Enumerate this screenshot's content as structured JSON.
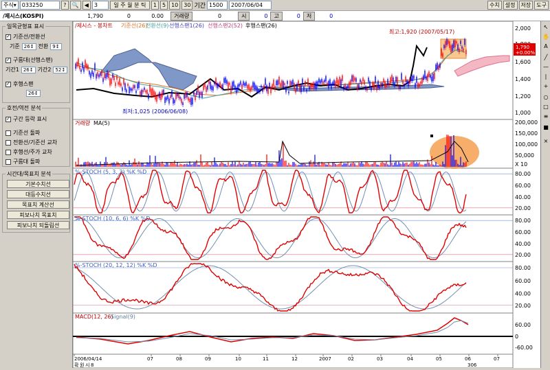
{
  "toolbar": {
    "market": "주식",
    "code": "033250",
    "count": "3",
    "mode": "일 주 월 분 틱",
    "periods": [
      "1",
      "5",
      "10",
      "30"
    ],
    "period_label": "기간",
    "period_value": "1500",
    "date": "2007/06/04",
    "right_buttons": [
      "수치",
      "설정",
      "저장",
      "도구"
    ]
  },
  "info": {
    "name": "/제시스(KOSPI)",
    "price": "1,790",
    "change": "0",
    "rate": "0.00",
    "vol_label": "거래량",
    "volume": "0",
    "open_label": "시",
    "open": "0",
    "high_label": "고",
    "high": "0",
    "low_label": "저",
    "low": "0"
  },
  "sidebar": {
    "ichimoku": {
      "title": "일목균형표 표시",
      "line1": "기준선/전환선",
      "base_label": "기준",
      "base_val": "26",
      "conv_label": "전환",
      "conv_val": "9",
      "cloud": "구름대(선행스팬)",
      "span1_label": "기간1",
      "span1_val": "26",
      "span2_label": "기간2",
      "span2_val": "52",
      "lag": "후행스팬",
      "lag_val": "26"
    },
    "signals": {
      "title": "호전/역전 분석",
      "items": [
        "구간 등락 표시",
        "기준선 돌파",
        "전환선/기준선 교차",
        "후행선/주가 교차",
        "구름대 돌파"
      ],
      "checked": [
        true,
        false,
        false,
        false,
        false
      ]
    },
    "tools": {
      "title": "시간대/목표치 분석",
      "buttons": [
        "기본수치선",
        "대등수치선",
        "목표치 계산선",
        "피보나치 목표치",
        "피보나치 되돌림선"
      ]
    }
  },
  "chart": {
    "main_legend": {
      "t1": "/제시스 - 봉차트",
      "t2": "기준선(26)",
      "t3": "전환선(9)",
      "t4": "선행스팬1(26)",
      "t5": "선행스팬2(52)",
      "t6": "후행스팬(26)"
    },
    "high_annot": "최고:1,920 (2007/05/17)",
    "low_annot": "최저:1,025 (2006/06/08)",
    "price_box": [
      "1,790",
      "+0.00%"
    ],
    "main_axis": [
      "2,000",
      "1,800",
      "1,600",
      "1,400",
      "1,200",
      "1,000"
    ],
    "vol_legend": {
      "t1": "거래량",
      "t2": "MA(5)"
    },
    "vol_axis": [
      "200,000",
      "150,000",
      "100,000",
      "50,000",
      "X 10"
    ],
    "st1": "%-STOCH (5, 3, 3) %K %D",
    "st2": "%-STOCH (10, 6, 6) %K %D",
    "st3": "%-STOCH (20, 12, 12) %K %D",
    "st_axis": [
      "80.00",
      "60.00",
      "40.00",
      "20.00"
    ],
    "macd_legend": {
      "t1": "MACD(12, 26)",
      "t2": "Signal(9)"
    },
    "macd_axis": [
      "60.00",
      "0",
      "-60.00"
    ],
    "x_labels": [
      "2006/04/14",
      "07",
      "08",
      "09",
      "10",
      "11",
      "12",
      "2007",
      "02",
      "03",
      "04",
      "05",
      "06",
      "07"
    ],
    "bottom_left": [
      "확",
      "원",
      "시",
      "8"
    ],
    "bottom_right": "306"
  },
  "colors": {
    "up": "#ff0000",
    "down": "#0000ff",
    "cloud": "#8098c8",
    "cloud2": "#f0a0b0",
    "base": "#e07020",
    "conv": "#40a0a0",
    "lag": "#000000"
  }
}
